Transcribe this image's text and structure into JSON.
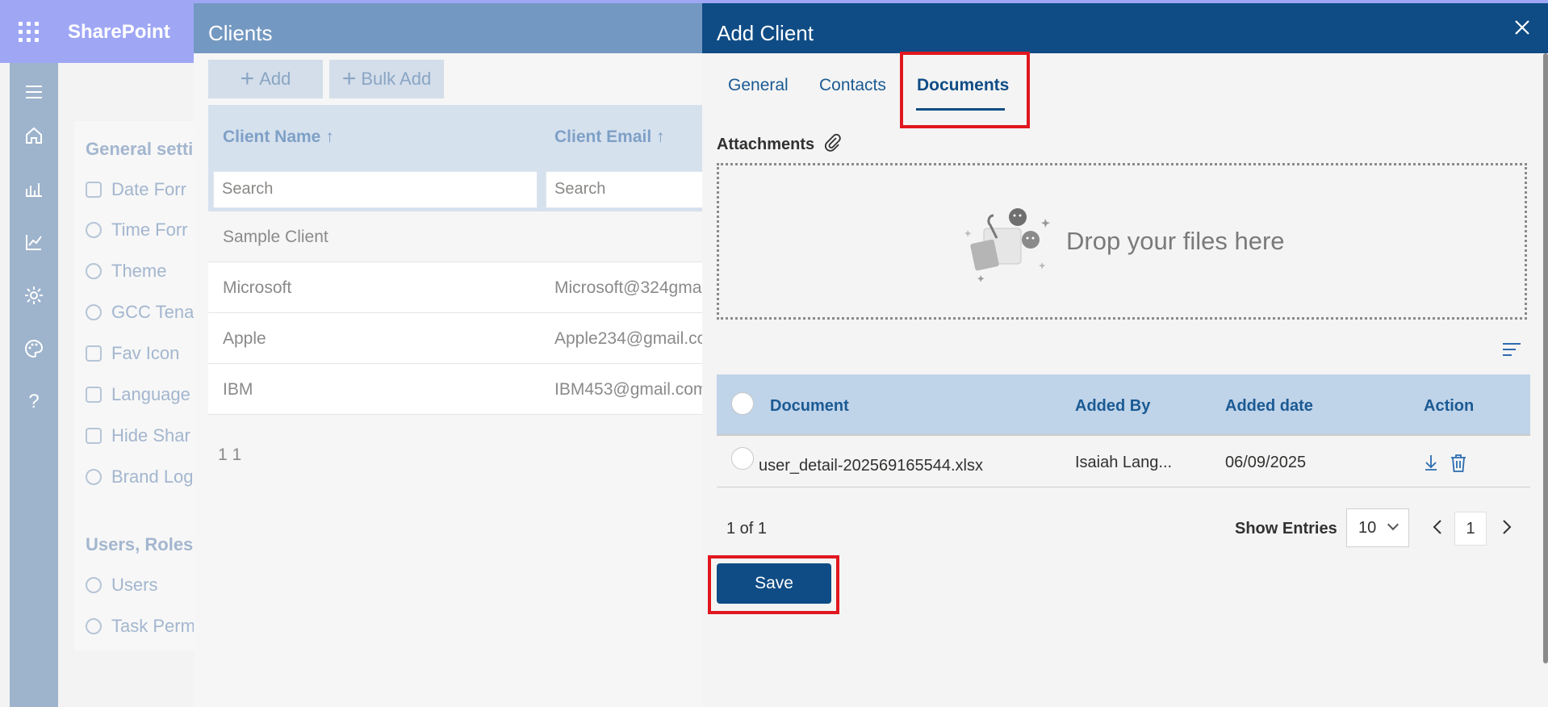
{
  "app": {
    "brand": "SharePoint"
  },
  "rail": {
    "icons": [
      "menu-icon",
      "home-icon",
      "analytics-icon",
      "trend-icon",
      "gear-icon",
      "palette-icon",
      "help-icon"
    ]
  },
  "settings": {
    "group1": "General setti",
    "items1": [
      "Date Forr",
      "Time Forr",
      "Theme",
      "GCC Tena",
      "Fav Icon",
      "Language",
      "Hide Shar",
      "Brand Log"
    ],
    "group2": "Users, Roles",
    "items2": [
      "Users",
      "Task Perm"
    ]
  },
  "clients": {
    "title": "Clients",
    "add_label": "Add",
    "bulk_add_label": "Bulk Add",
    "columns": [
      "Client Name ↑",
      "Client Email ↑"
    ],
    "search_placeholder": "Search",
    "rows": [
      {
        "name": "Sample Client",
        "email": ""
      },
      {
        "name": "Microsoft",
        "email": "Microsoft@324gma"
      },
      {
        "name": "Apple",
        "email": "Apple234@gmail.co"
      },
      {
        "name": "IBM",
        "email": "IBM453@gmail.com"
      }
    ],
    "pager": "1 1"
  },
  "drawer": {
    "title": "Add Client",
    "tabs": [
      "General",
      "Contacts",
      "Documents"
    ],
    "active_tab": "Documents",
    "attachments_label": "Attachments",
    "drop_text": "Drop your files here",
    "columns": {
      "document": "Document",
      "added_by": "Added By",
      "added_date": "Added date",
      "action": "Action"
    },
    "rows": [
      {
        "document": "user_detail-202569165544.xlsx",
        "added_by": "Isaiah Lang...",
        "added_date": "06/09/2025"
      }
    ],
    "pager_count": "1 of 1",
    "show_entries_label": "Show Entries",
    "entries_value": "10",
    "current_page": "1",
    "save_label": "Save"
  },
  "colors": {
    "header": "#0f4c85",
    "highlight": "#e0171f",
    "suitebar": "#9fa7f5"
  }
}
